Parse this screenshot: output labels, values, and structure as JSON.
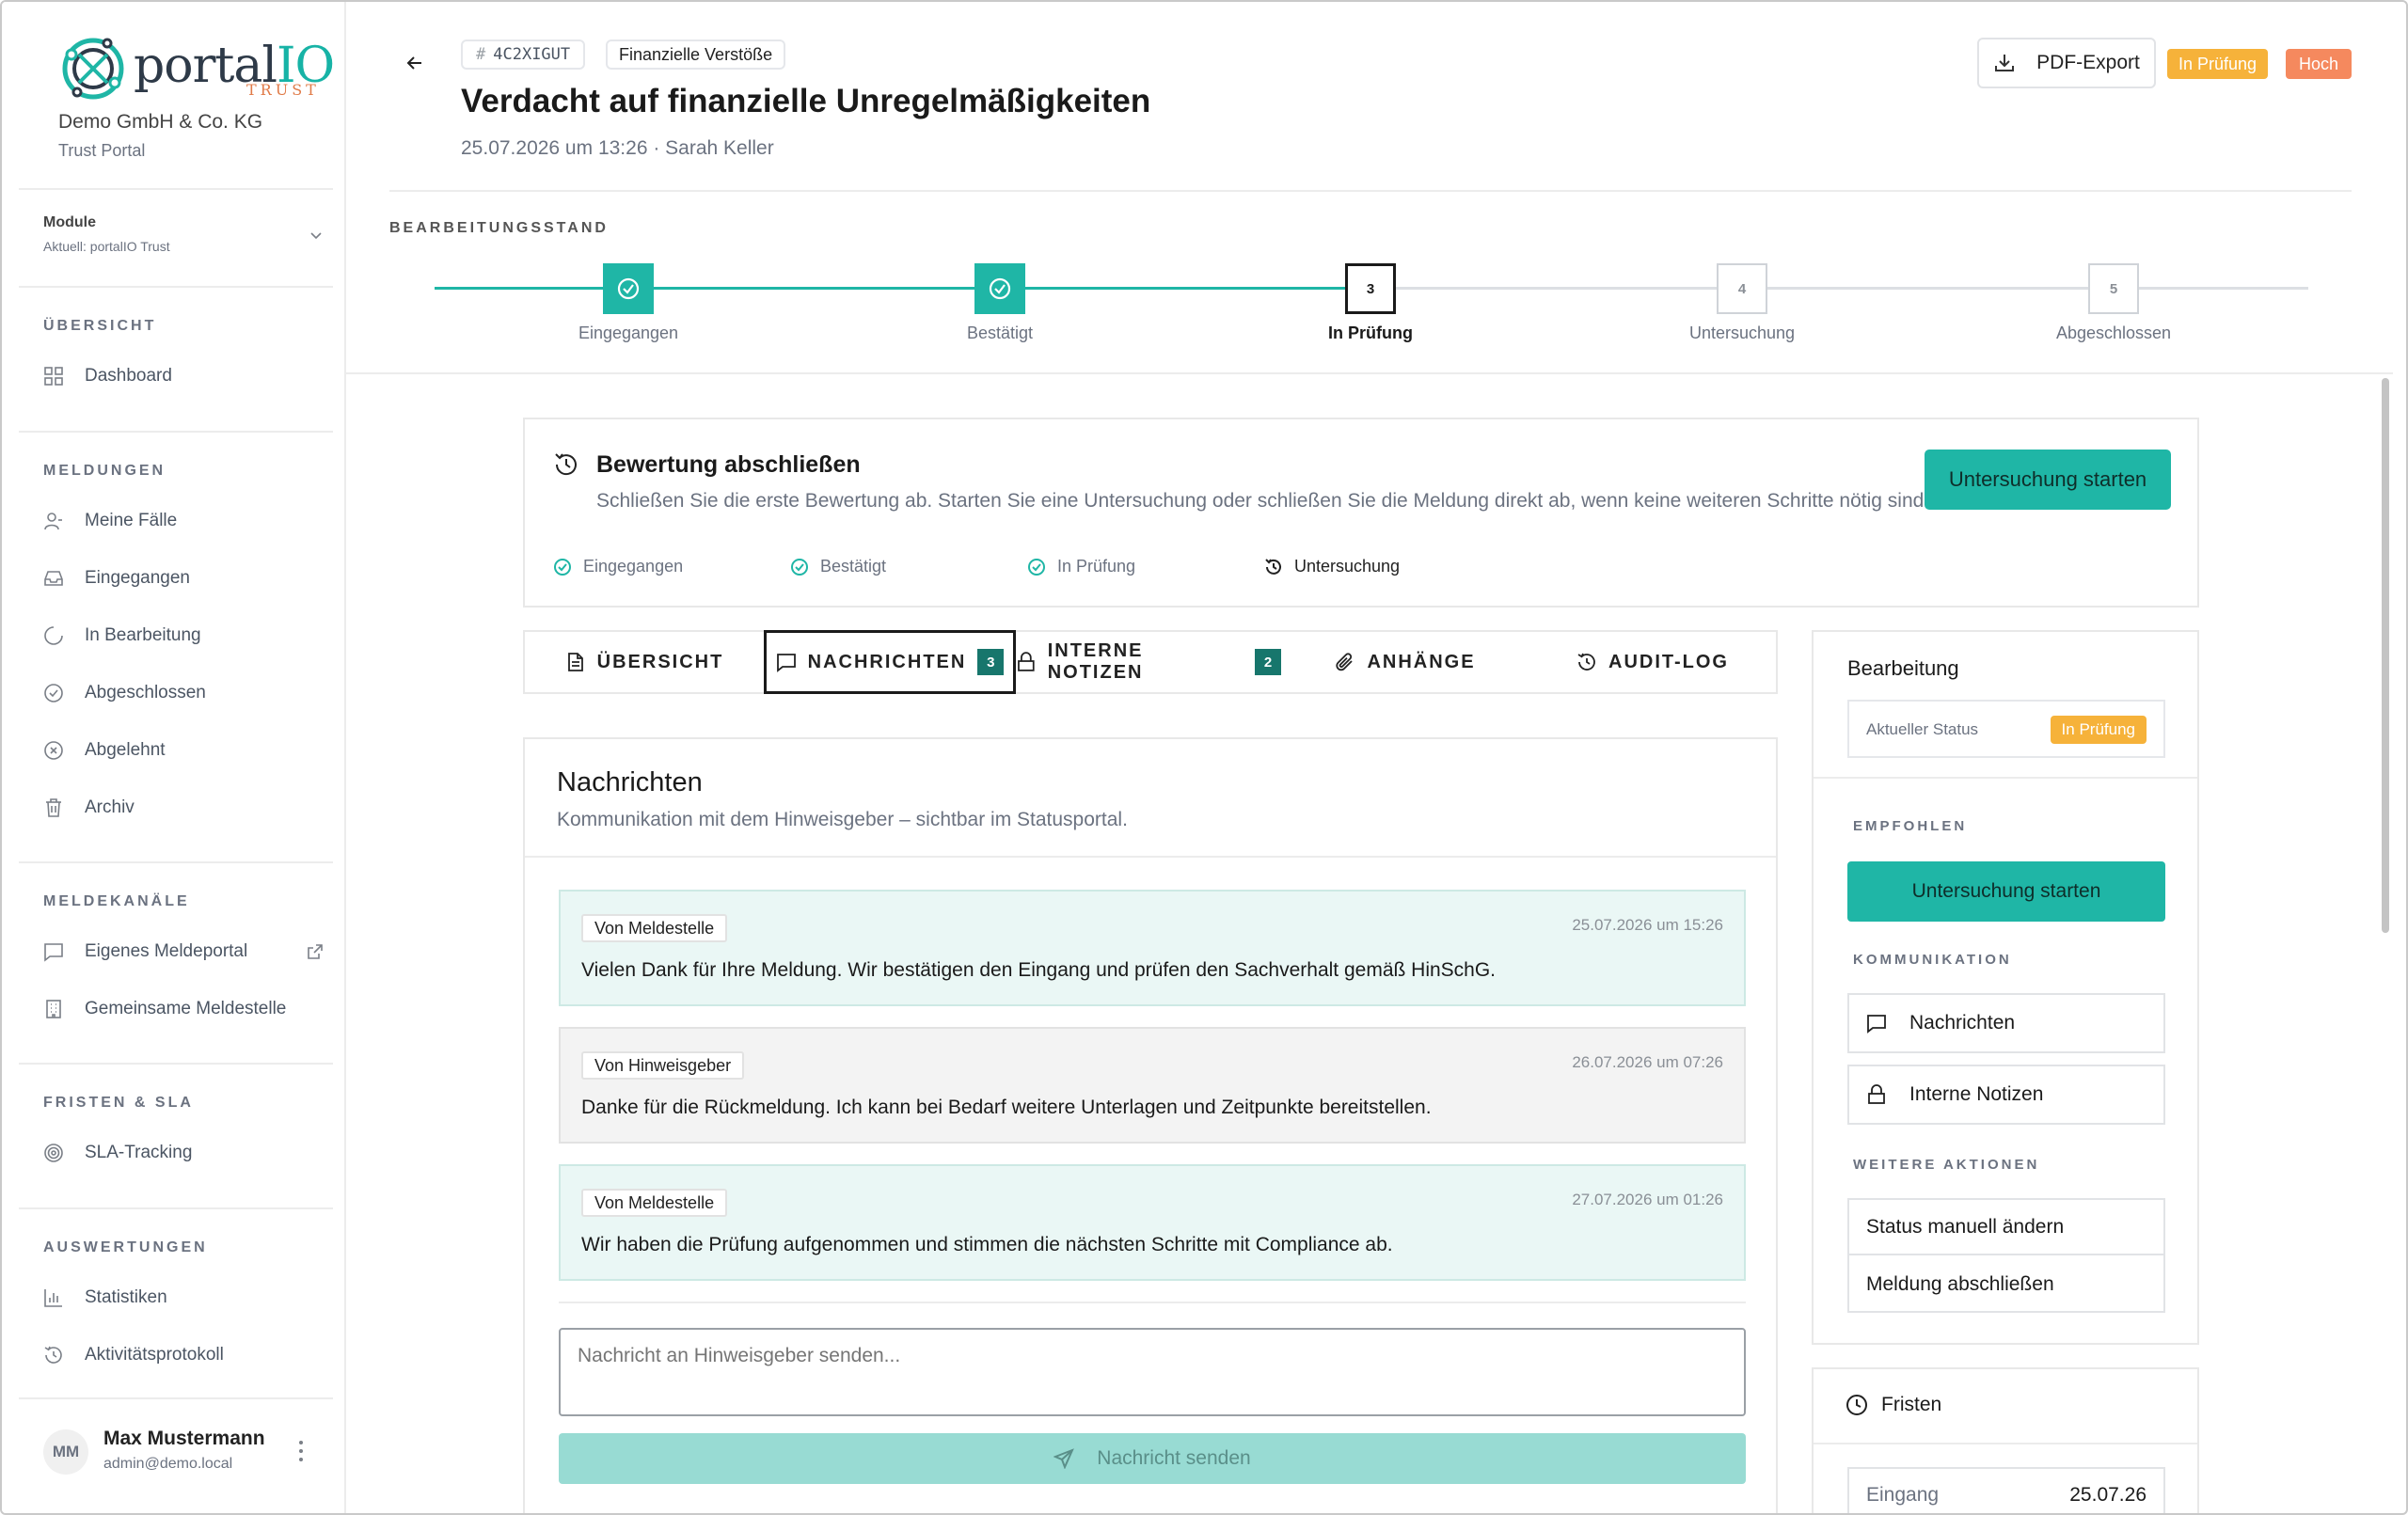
{
  "brand": {
    "name_main": "portal",
    "name_accent": "IO",
    "tagline": "TRUST",
    "company": "Demo GmbH & Co. KG",
    "company_sub": "Trust Portal"
  },
  "module": {
    "title": "Module",
    "current": "Aktuell: portalIO Trust"
  },
  "sidebar": {
    "sections": [
      {
        "title": "ÜBERSICHT",
        "items": [
          {
            "label": "Dashboard",
            "icon": "dashboard-icon"
          }
        ]
      },
      {
        "title": "MELDUNGEN",
        "items": [
          {
            "label": "Meine Fälle",
            "icon": "user-icon"
          },
          {
            "label": "Eingegangen",
            "icon": "inbox-icon"
          },
          {
            "label": "In Bearbeitung",
            "icon": "loader-icon"
          },
          {
            "label": "Abgeschlossen",
            "icon": "check-circle-icon"
          },
          {
            "label": "Abgelehnt",
            "icon": "x-circle-icon"
          },
          {
            "label": "Archiv",
            "icon": "trash-icon"
          }
        ]
      },
      {
        "title": "MELDEKANÄLE",
        "items": [
          {
            "label": "Eigenes Meldeportal",
            "icon": "message-icon"
          },
          {
            "label": "Gemeinsame Meldestelle",
            "icon": "building-icon"
          }
        ]
      },
      {
        "title": "FRISTEN & SLA",
        "items": [
          {
            "label": "SLA-Tracking",
            "icon": "target-icon"
          }
        ]
      },
      {
        "title": "AUSWERTUNGEN",
        "items": [
          {
            "label": "Statistiken",
            "icon": "bar-chart-icon"
          },
          {
            "label": "Aktivitätsprotokoll",
            "icon": "history-icon"
          }
        ]
      }
    ]
  },
  "user": {
    "initials": "MM",
    "name": "Max Mustermann",
    "email": "admin@demo.local"
  },
  "header": {
    "case_id": "4C2XIGUT",
    "case_id_prefix": "#",
    "category": "Finanzielle Verstöße",
    "title": "Verdacht auf finanzielle Unregelmäßigkeiten",
    "meta": "25.07.2026 um 13:26 · Sarah Keller",
    "pdf_label": "PDF-Export",
    "status_badge": "In Prüfung",
    "priority_badge": "Hoch"
  },
  "stepper": {
    "title": "BEARBEITUNGSSTAND",
    "steps": [
      {
        "num": "1",
        "label": "Eingegangen",
        "state": "done"
      },
      {
        "num": "2",
        "label": "Bestätigt",
        "state": "done"
      },
      {
        "num": "3",
        "label": "In Prüfung",
        "state": "current"
      },
      {
        "num": "4",
        "label": "Untersuchung",
        "state": "todo"
      },
      {
        "num": "5",
        "label": "Abgeschlossen",
        "state": "todo"
      }
    ]
  },
  "evaluation": {
    "title": "Bewertung abschließen",
    "description": "Schließen Sie die erste Bewertung ab. Starten Sie eine Untersuchung oder schließen Sie die Meldung direkt ab, wenn keine weiteren Schritte nötig sind.",
    "button": "Untersuchung starten",
    "steps": [
      "Eingegangen",
      "Bestätigt",
      "In Prüfung",
      "Untersuchung"
    ]
  },
  "tabs": [
    {
      "label": "ÜBERSICHT",
      "count": ""
    },
    {
      "label": "NACHRICHTEN",
      "count": "3"
    },
    {
      "label": "INTERNE NOTIZEN",
      "count": "2"
    },
    {
      "label": "ANHÄNGE",
      "count": ""
    },
    {
      "label": "AUDIT-LOG",
      "count": ""
    }
  ],
  "messages": {
    "title": "Nachrichten",
    "subtitle": "Kommunikation mit dem Hinweisgeber – sichtbar im Statusportal.",
    "items": [
      {
        "from": "Von Meldestelle",
        "time": "25.07.2026 um 15:26",
        "text": "Vielen Dank für Ihre Meldung. Wir bestätigen den Eingang und prüfen den Sachverhalt gemäß HinSchG."
      },
      {
        "from": "Von Hinweisgeber",
        "time": "26.07.2026 um 07:26",
        "text": "Danke für die Rückmeldung. Ich kann bei Bedarf weitere Unterlagen und Zeitpunkte bereitstellen."
      },
      {
        "from": "Von Meldestelle",
        "time": "27.07.2026 um 01:26",
        "text": "Wir haben die Prüfung aufgenommen und stimmen die nächsten Schritte mit Compliance ab."
      }
    ],
    "composer_placeholder": "Nachricht an Hinweisgeber senden...",
    "send_label": "Nachricht senden"
  },
  "panel": {
    "title": "Bearbeitung",
    "status_label": "Aktueller Status",
    "status_value": "In Prüfung",
    "recommended_title": "EMPFOHLEN",
    "recommended_button": "Untersuchung starten",
    "communication_title": "KOMMUNIKATION",
    "communication_messages": "Nachrichten",
    "communication_notes": "Interne Notizen",
    "more_title": "WEITERE AKTIONEN",
    "more_change_status": "Status manuell ändern",
    "more_close": "Meldung abschließen"
  },
  "deadlines": {
    "title": "Fristen",
    "rows": [
      {
        "label": "Eingang",
        "value": "25.07.26"
      }
    ]
  },
  "colors": {
    "accent": "#1fb6a6",
    "accent_dark": "#17766c",
    "status_orange": "#f6b23a",
    "priority_red": "#f5895e"
  }
}
